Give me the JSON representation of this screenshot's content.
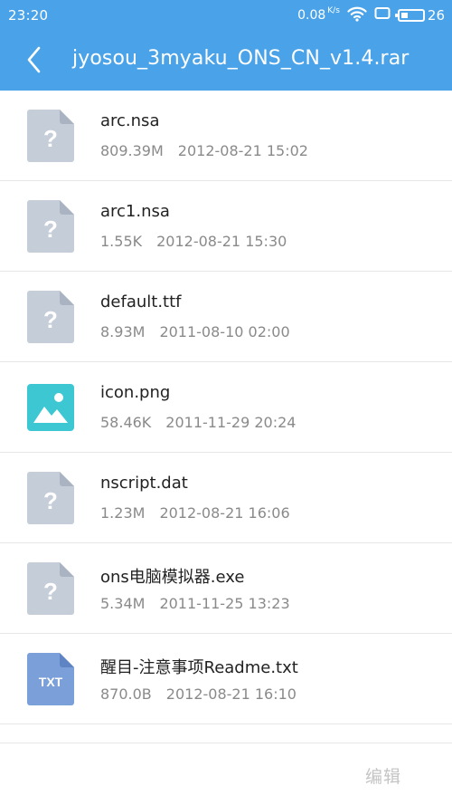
{
  "status_bar": {
    "time": "23:20",
    "net_speed": "0.08",
    "net_speed_unit": "K/s",
    "battery_level": "26"
  },
  "header": {
    "title": "jyosou_3myaku_ONS_CN_v1.4.rar",
    "back_icon": "back-chevron-icon"
  },
  "files": [
    {
      "name": "arc.nsa",
      "size": "809.39M",
      "date": "2012-08-21 15:02",
      "icon": "unknown-file-icon"
    },
    {
      "name": "arc1.nsa",
      "size": "1.55K",
      "date": "2012-08-21 15:30",
      "icon": "unknown-file-icon"
    },
    {
      "name": "default.ttf",
      "size": "8.93M",
      "date": "2011-08-10 02:00",
      "icon": "unknown-file-icon"
    },
    {
      "name": "icon.png",
      "size": "58.46K",
      "date": "2011-11-29 20:24",
      "icon": "image-file-icon"
    },
    {
      "name": "nscript.dat",
      "size": "1.23M",
      "date": "2012-08-21 16:06",
      "icon": "unknown-file-icon"
    },
    {
      "name": "ons电脑模拟器.exe",
      "size": "5.34M",
      "date": "2011-11-25 13:23",
      "icon": "unknown-file-icon"
    },
    {
      "name": "醒目-注意事项Readme.txt",
      "size": "870.0B",
      "date": "2012-08-21 16:10",
      "icon": "txt-file-icon",
      "icon_label": "TXT"
    }
  ],
  "bottom_bar": {
    "edit_label": "编辑"
  },
  "colors": {
    "header_blue": "#4aa3e8",
    "unknown_icon_gray": "#c5cdd8",
    "image_icon_teal": "#3cc7d2",
    "txt_icon_blue": "#7b9fd9"
  }
}
